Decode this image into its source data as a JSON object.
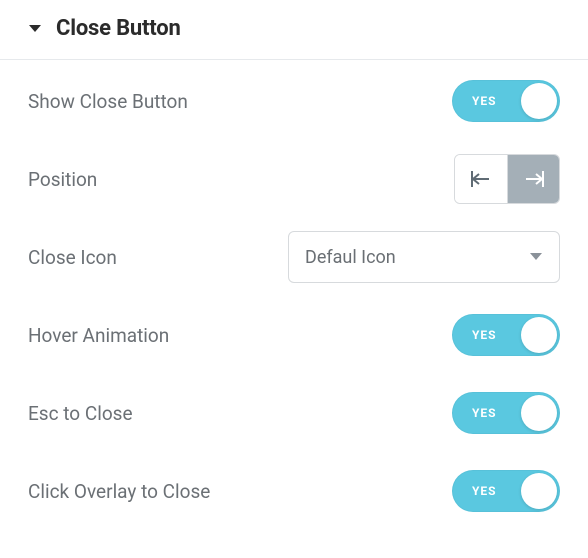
{
  "section": {
    "title": "Close Button"
  },
  "rows": {
    "show": {
      "label": "Show Close Button",
      "toggle_text": "YES"
    },
    "position": {
      "label": "Position"
    },
    "icon": {
      "label": "Close Icon",
      "selected": "Defaul Icon"
    },
    "hover": {
      "label": "Hover Animation",
      "toggle_text": "YES"
    },
    "esc": {
      "label": "Esc to Close",
      "toggle_text": "YES"
    },
    "overlay": {
      "label": "Click Overlay to Close",
      "toggle_text": "YES"
    }
  }
}
